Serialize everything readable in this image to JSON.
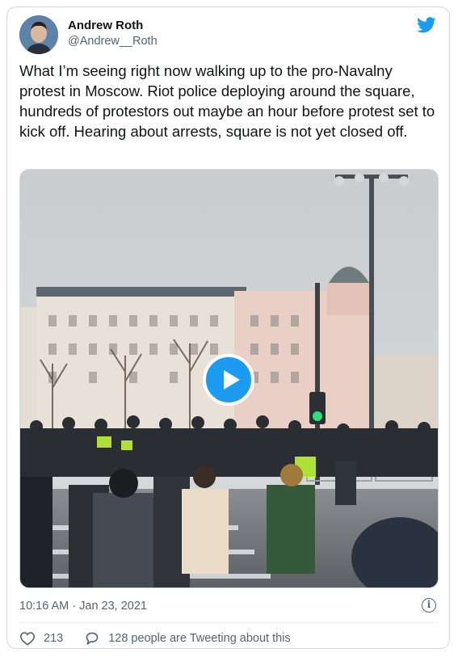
{
  "author": {
    "name": "Andrew Roth",
    "handle": "@Andrew__Roth"
  },
  "tweet": {
    "text": "What I’m seeing right now walking up to the pro-Navalny protest in Moscow. Riot police deploying around the square, hundreds of protestors out maybe an hour before protest set to kick off. Hearing about arrests, square is not yet closed off.",
    "timestamp": "10:16 AM · Jan 23, 2021"
  },
  "actions": {
    "likes": "213",
    "discussion": "128 people are Tweeting about this"
  },
  "icons": {
    "brand": "twitter-bird-icon",
    "play": "play-icon",
    "info": "info-icon",
    "like": "heart-icon",
    "reply": "speech-bubble-icon"
  },
  "colors": {
    "accent": "#1d9bf0",
    "secondary_text": "#536471",
    "border": "#cfd9de"
  }
}
